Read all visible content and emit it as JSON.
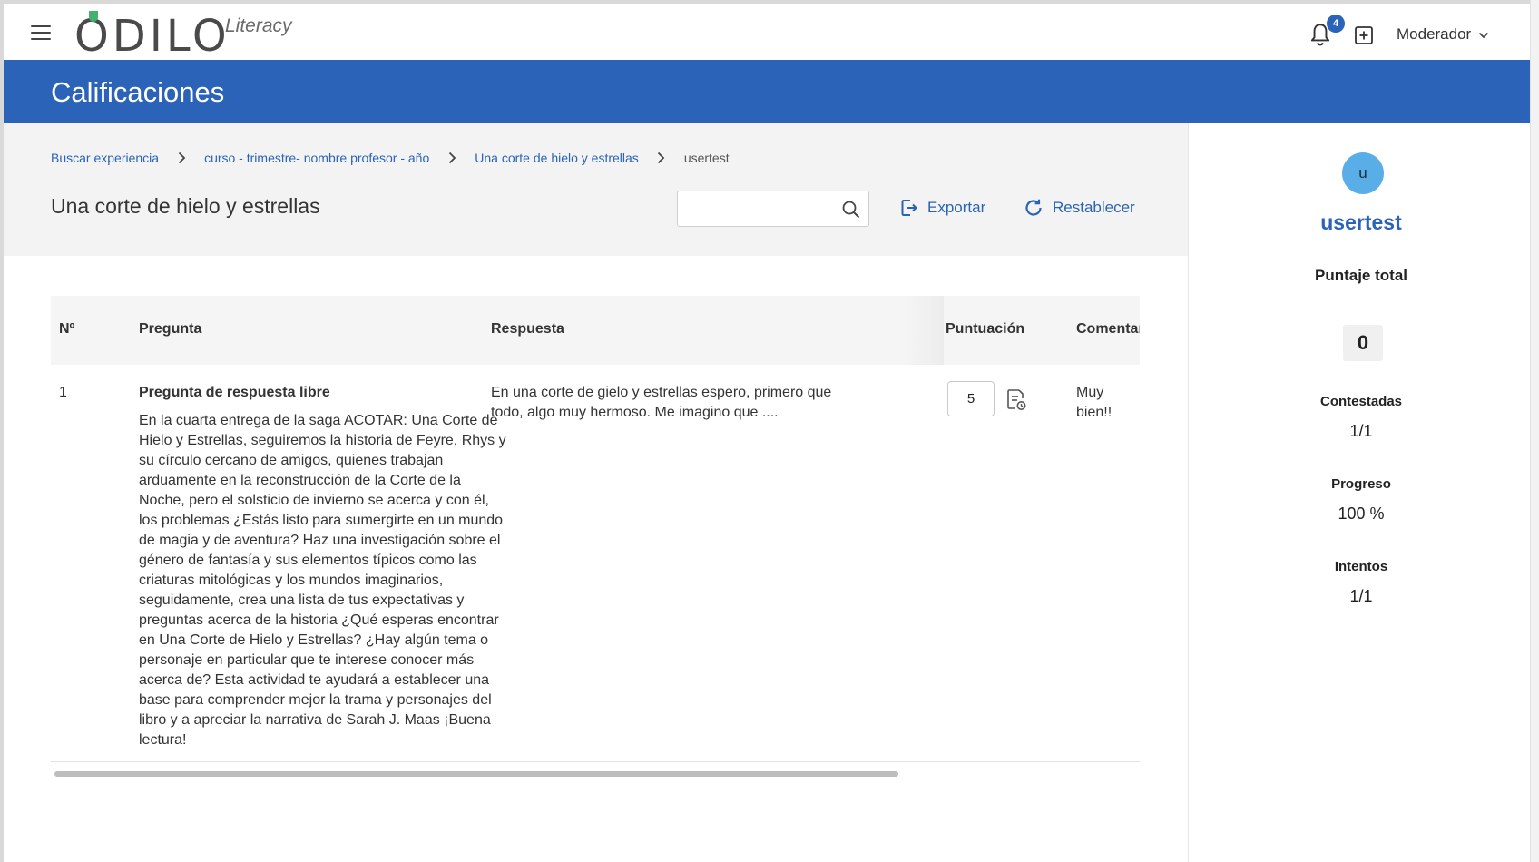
{
  "app": {
    "brand": "ODILO",
    "brand_sub": "Literacy",
    "notifications_count": "4",
    "user_menu_label": "Moderador"
  },
  "header": {
    "title": "Calificaciones"
  },
  "breadcrumb": {
    "items": [
      "Buscar experiencia",
      "curso - trimestre- nombre profesor - año",
      "Una corte de hielo y estrellas",
      "usertest"
    ]
  },
  "experience": {
    "title": "Una corte de hielo y estrellas"
  },
  "search": {
    "value": "",
    "placeholder": ""
  },
  "actions": {
    "export_label": "Exportar",
    "reset_label": "Restablecer"
  },
  "table": {
    "columns": [
      "Nº",
      "Pregunta",
      "Respuesta",
      "Puntuación",
      "Comentar"
    ],
    "rows": [
      {
        "number": "1",
        "question_title": "Pregunta de respuesta libre",
        "question_text": "En la cuarta entrega de la saga ACOTAR: Una Corte de Hielo y Estrellas, seguiremos la historia de Feyre, Rhys y su círculo cercano de amigos, quienes trabajan arduamente en la reconstrucción de la Corte de la Noche, pero el solsticio de invierno se acerca y con él, los problemas ¿Estás listo para sumergirte en un mundo de magia y de aventura? Haz una investigación sobre el género de fantasía y sus elementos típicos como las criaturas mitológicas y los mundos imaginarios, seguidamente, crea una lista de tus expectativas y preguntas acerca de la historia ¿Qué esperas encontrar en Una Corte de Hielo y Estrellas? ¿Hay algún tema o personaje en particular que te interese conocer más acerca de? Esta actividad te ayudará a establecer una base para comprender mejor la trama y personajes del libro y a apreciar la narrativa de Sarah J. Maas ¡Buena lectura!",
        "answer": "En una corte de gielo y estrellas espero, primero que todo, algo muy hermoso. Me imagino que ....",
        "score": "5",
        "comment": "Muy bien!!"
      }
    ]
  },
  "user_panel": {
    "avatar_initial": "u",
    "username": "usertest",
    "total_label": "Puntaje total",
    "total_value": "0",
    "answered_label": "Contestadas",
    "answered_value": "1/1",
    "progress_label": "Progreso",
    "progress_value": "100 %",
    "attempts_label": "Intentos",
    "attempts_value": "1/1"
  },
  "colors": {
    "primary": "#2a63b8",
    "logo_leaf": "#3fb36b",
    "avatar_bg": "#5aaee8"
  },
  "icons": {
    "menu": "hamburger-icon",
    "notifications": "bell-icon",
    "add": "plus-square-icon",
    "dropdown": "chevron-down-icon",
    "breadcrumb_separator": "chevron-right-icon",
    "search": "search-icon",
    "export": "export-icon",
    "reset": "refresh-icon",
    "feedback": "document-feedback-icon"
  }
}
